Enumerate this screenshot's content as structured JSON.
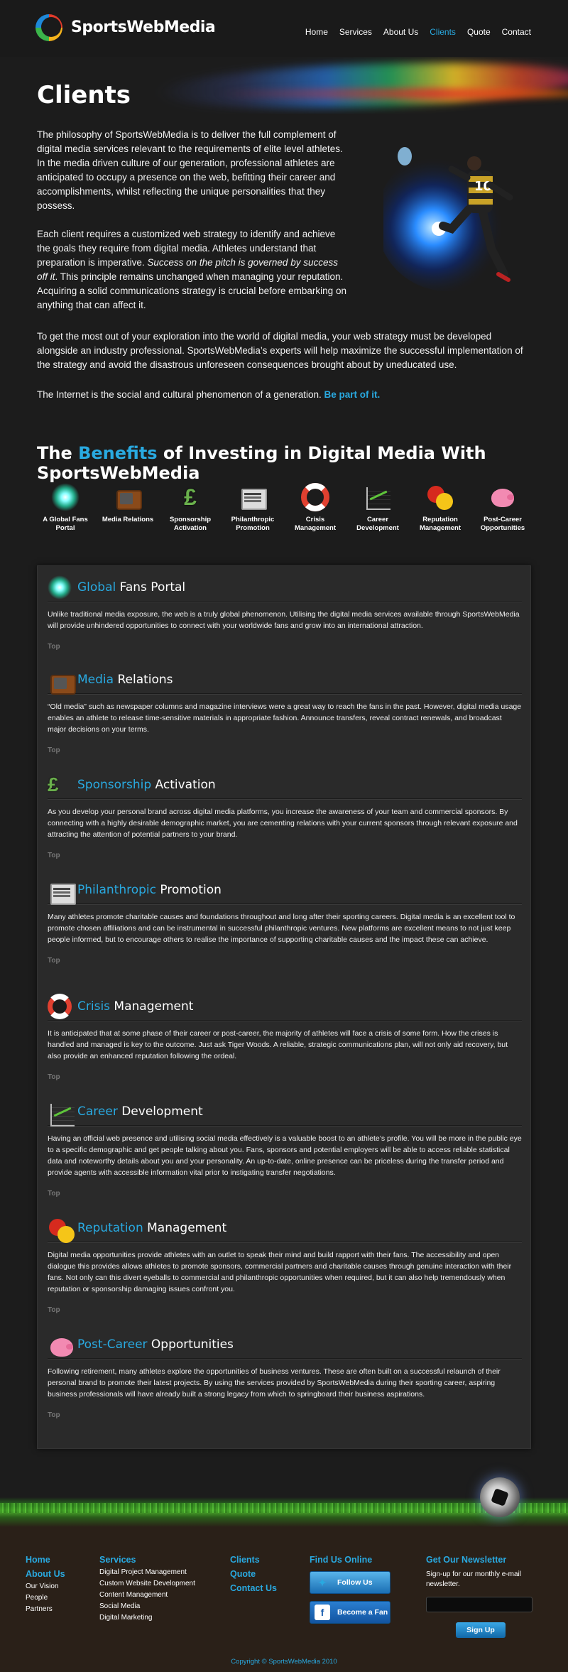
{
  "header": {
    "brand": "SportsWebMedia",
    "nav": [
      "Home",
      "Services",
      "About Us",
      "Clients",
      "Quote",
      "Contact"
    ],
    "active_nav": "Clients"
  },
  "hero": {
    "title": "Clients"
  },
  "intro": {
    "p1": "The philosophy of SportsWebMedia is to deliver the full complement of digital media services relevant to the requirements of elite level athletes. In the media driven culture of our generation, professional athletes are anticipated to occupy a presence on the web, befitting their career and accomplishments, whilst reflecting the unique personalities that they possess.",
    "p2_start": "Each client requires a customized web strategy to identify and achieve the goals they require from digital media. Athletes understand that preparation is imperative. ",
    "p2_em": "Success on the pitch is governed by success off it",
    "p2_end": ". This principle remains unchanged when managing your reputation. Acquiring a solid communications strategy is crucial before embarking on anything that can affect it.",
    "p3": "To get the most out of your exploration into the world of digital media, your web strategy must be developed alongside an industry professional. SportsWebMedia’s experts will help maximize the successful implementation of the strategy and avoid the disastrous unforeseen consequences brought about by uneducated use.",
    "p4": "The Internet is the social and cultural phenomenon of a generation.",
    "cta": "Be part of it."
  },
  "benefits": {
    "title_pre": "The ",
    "title_hl": "Benefits",
    "title_post": " of Investing in Digital Media With SportsWebMedia",
    "icons": [
      {
        "label": "A Global Fans Portal",
        "icon": "globe-icon"
      },
      {
        "label": "Media Relations",
        "icon": "tv-icon"
      },
      {
        "label": "Sponsorship Activation",
        "icon": "pound-icon"
      },
      {
        "label": "Philanthropic Promotion",
        "icon": "press-icon"
      },
      {
        "label": "Crisis Management",
        "icon": "lifebuoy-icon"
      },
      {
        "label": "Career Development",
        "icon": "chart-icon"
      },
      {
        "label": "Reputation Management",
        "icon": "faces-icon"
      },
      {
        "label": "Post-Career Opportunities",
        "icon": "piggy-bank-icon"
      }
    ]
  },
  "sections": [
    {
      "hl": "Global",
      "rest": " Fans Portal",
      "body": "Unlike traditional media exposure, the web is a truly global phenomenon. Utilising the digital media services available through SportsWebMedia will provide unhindered opportunities to connect with your worldwide fans and grow into an international attraction.",
      "top": "Top"
    },
    {
      "hl": "Media",
      "rest": " Relations",
      "body": "“Old media” such as newspaper columns and magazine interviews were a great way to reach the fans in the past. However, digital media usage enables an athlete to release time-sensitive materials in appropriate fashion. Announce transfers, reveal contract renewals, and broadcast major decisions on your terms.",
      "top": "Top"
    },
    {
      "hl": "Sponsorship",
      "rest": " Activation",
      "body": "As you develop your personal brand across digital media platforms, you increase the awareness of your team and commercial sponsors. By connecting with a highly desirable demographic market, you are cementing relations with your current sponsors through relevant exposure and attracting the attention of potential partners to your brand.",
      "top": "Top"
    },
    {
      "hl": "Philanthropic",
      "rest": " Promotion",
      "body": "Many athletes promote charitable causes and foundations throughout and long after their sporting careers. Digital media is an excellent tool to promote chosen affiliations and can be instrumental in successful philanthropic ventures. New platforms are excellent means to not just keep people informed, but to encourage others to realise the importance of supporting charitable causes and the impact these can achieve.",
      "top": "Top"
    },
    {
      "hl": "Crisis",
      "rest": " Management",
      "body": "It is anticipated that at some phase of their career or post-career, the majority of athletes will face a crisis of some form. How the crises is handled and managed is key to the outcome. Just ask Tiger Woods. A reliable, strategic communications plan, will not only aid recovery, but also provide an enhanced reputation following the ordeal.",
      "top": "Top"
    },
    {
      "hl": "Career",
      "rest": " Development",
      "body": "Having an official web presence and utilising social media effectively is a valuable boost to an athlete’s profile. You will be more in the public eye to a specific demographic and get people talking about you. Fans, sponsors and potential employers will be able to access reliable statistical data and noteworthy details about you and your personality. An up-to-date, online presence can be priceless during the transfer period and provide agents with accessible information vital prior to instigating transfer negotiations.",
      "top": "Top"
    },
    {
      "hl": "Reputation",
      "rest": " Management",
      "body": "Digital media opportunities provide athletes with an outlet to speak their mind and build rapport with their fans. The accessibility and open dialogue this provides allows athletes to promote sponsors, commercial partners and charitable causes through genuine interaction with their fans. Not only can this divert eyeballs to commercial and philanthropic opportunities when required, but it can also help tremendously when reputation or sponsorship damaging issues confront you.",
      "top": "Top"
    },
    {
      "hl": "Post-Career",
      "rest": " Opportunities",
      "body": "Following retirement, many athletes explore the opportunities of business ventures. These are often built on a successful relaunch of their personal brand to promote their latest projects. By using the services provided by SportsWebMedia during their sporting career, aspiring business professionals will have already built a strong legacy from which to springboard their business aspirations.",
      "top": "Top"
    }
  ],
  "footer": {
    "col1": {
      "home": "Home",
      "about": "About Us",
      "links": [
        "Our Vision",
        "People",
        "Partners"
      ]
    },
    "col2": {
      "heading": "Services",
      "links": [
        "Digital Project Management",
        "Custom Website Development",
        "Content Management",
        "Social Media",
        "Digital Marketing"
      ]
    },
    "col3": {
      "links": [
        "Clients",
        "Quote",
        "Contact Us"
      ]
    },
    "col4": {
      "heading": "Find Us Online",
      "twitter": "Follow Us",
      "facebook": "Become a Fan"
    },
    "col5": {
      "heading": "Get Our Newsletter",
      "text": "Sign-up for our monthly e-mail newsletter.",
      "button": "Sign Up"
    },
    "copyright": "Copyright © SportsWebMedia 2010"
  },
  "colors": {
    "accent": "#29a9e0",
    "background": "#1c1c1c",
    "panel": "#2a2a2a"
  }
}
